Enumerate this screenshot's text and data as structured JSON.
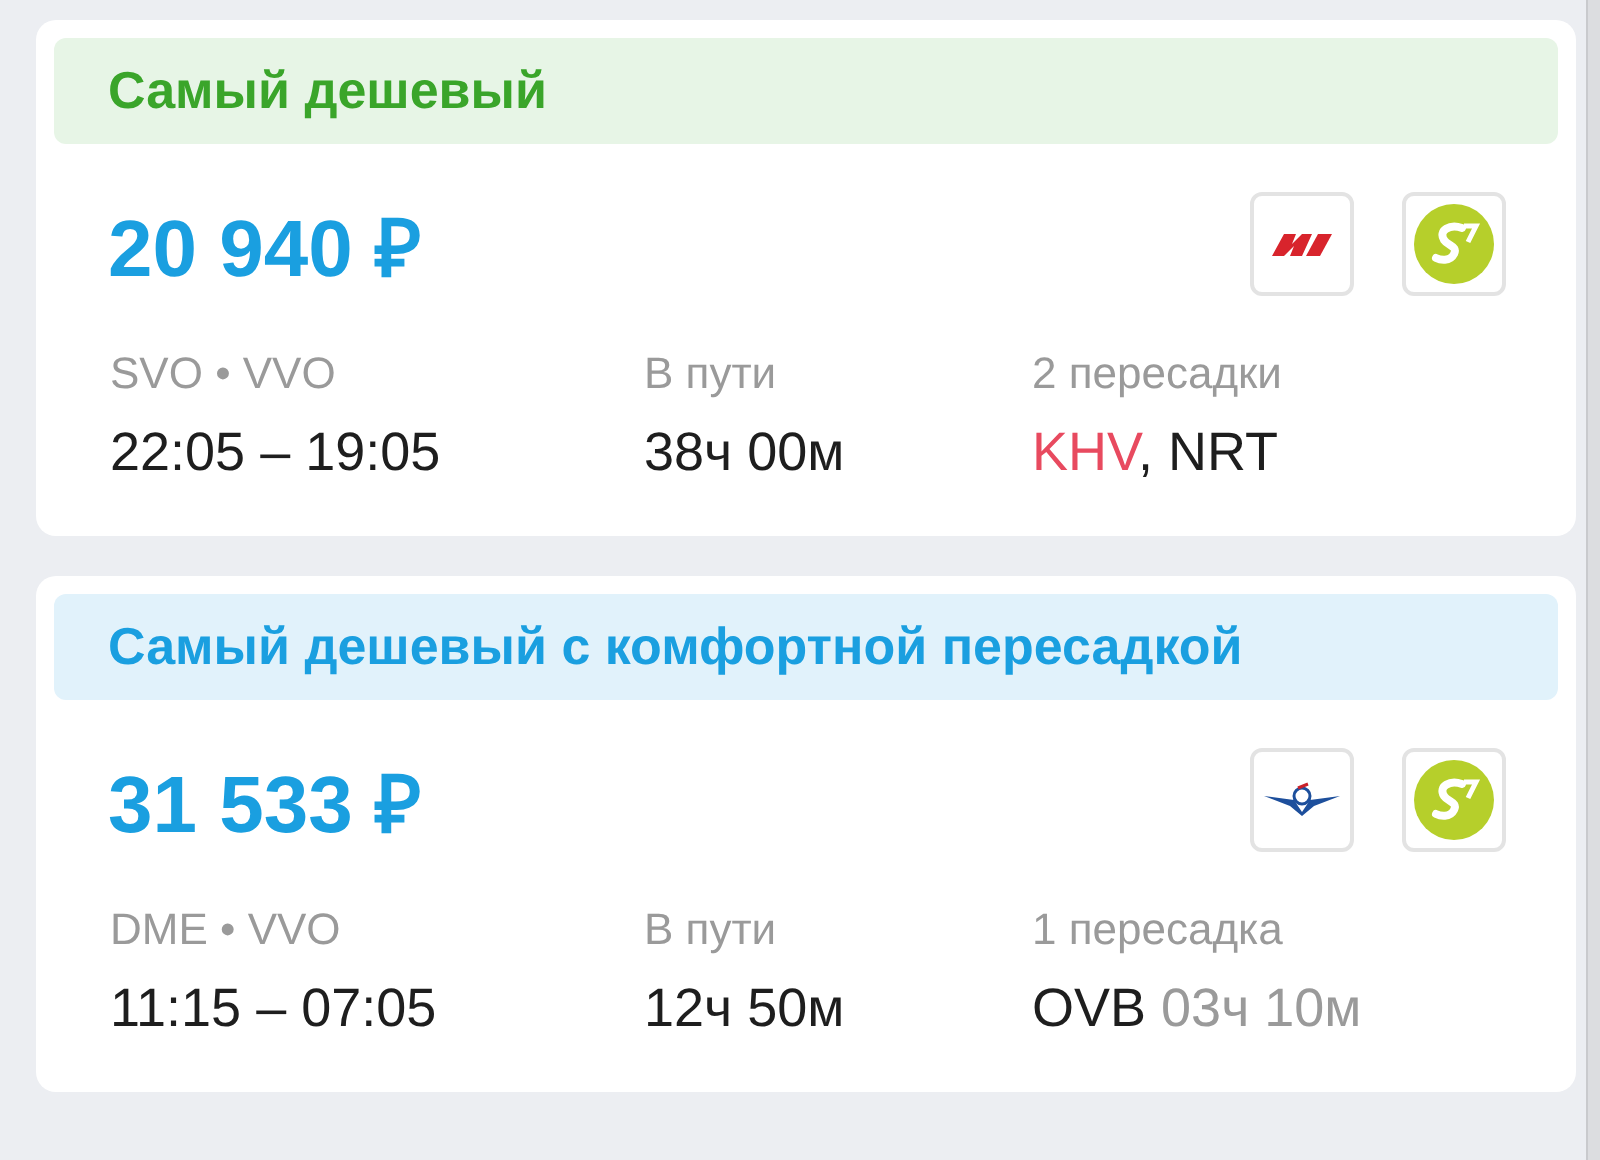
{
  "offers": [
    {
      "banner": {
        "text": "Самый дешевый",
        "kind": "cheapest"
      },
      "price": "20 940 ₽",
      "airlines": [
        {
          "kind": "nordwind"
        },
        {
          "kind": "s7"
        }
      ],
      "route": {
        "label": "SVO • VVO",
        "value": "22:05 – 19:05"
      },
      "duration": {
        "label": "В пути",
        "value": "38ч 00м"
      },
      "stops": {
        "label": "2 пересадки",
        "parts": [
          {
            "text": "KHV",
            "kind": "alert"
          },
          {
            "text": ", NRT",
            "kind": "normal"
          }
        ]
      }
    },
    {
      "banner": {
        "text": "Самый дешевый с комфортной пересадкой",
        "kind": "comfort"
      },
      "price": "31 533 ₽",
      "airlines": [
        {
          "kind": "aeroflot"
        },
        {
          "kind": "s7"
        }
      ],
      "route": {
        "label": "DME • VVO",
        "value": "11:15 – 07:05"
      },
      "duration": {
        "label": "В пути",
        "value": "12ч 50м"
      },
      "stops": {
        "label": "1 пересадка",
        "parts": [
          {
            "text": "OVB",
            "kind": "normal"
          },
          {
            "text": " 03ч 10м",
            "kind": "muted"
          }
        ]
      }
    }
  ]
}
